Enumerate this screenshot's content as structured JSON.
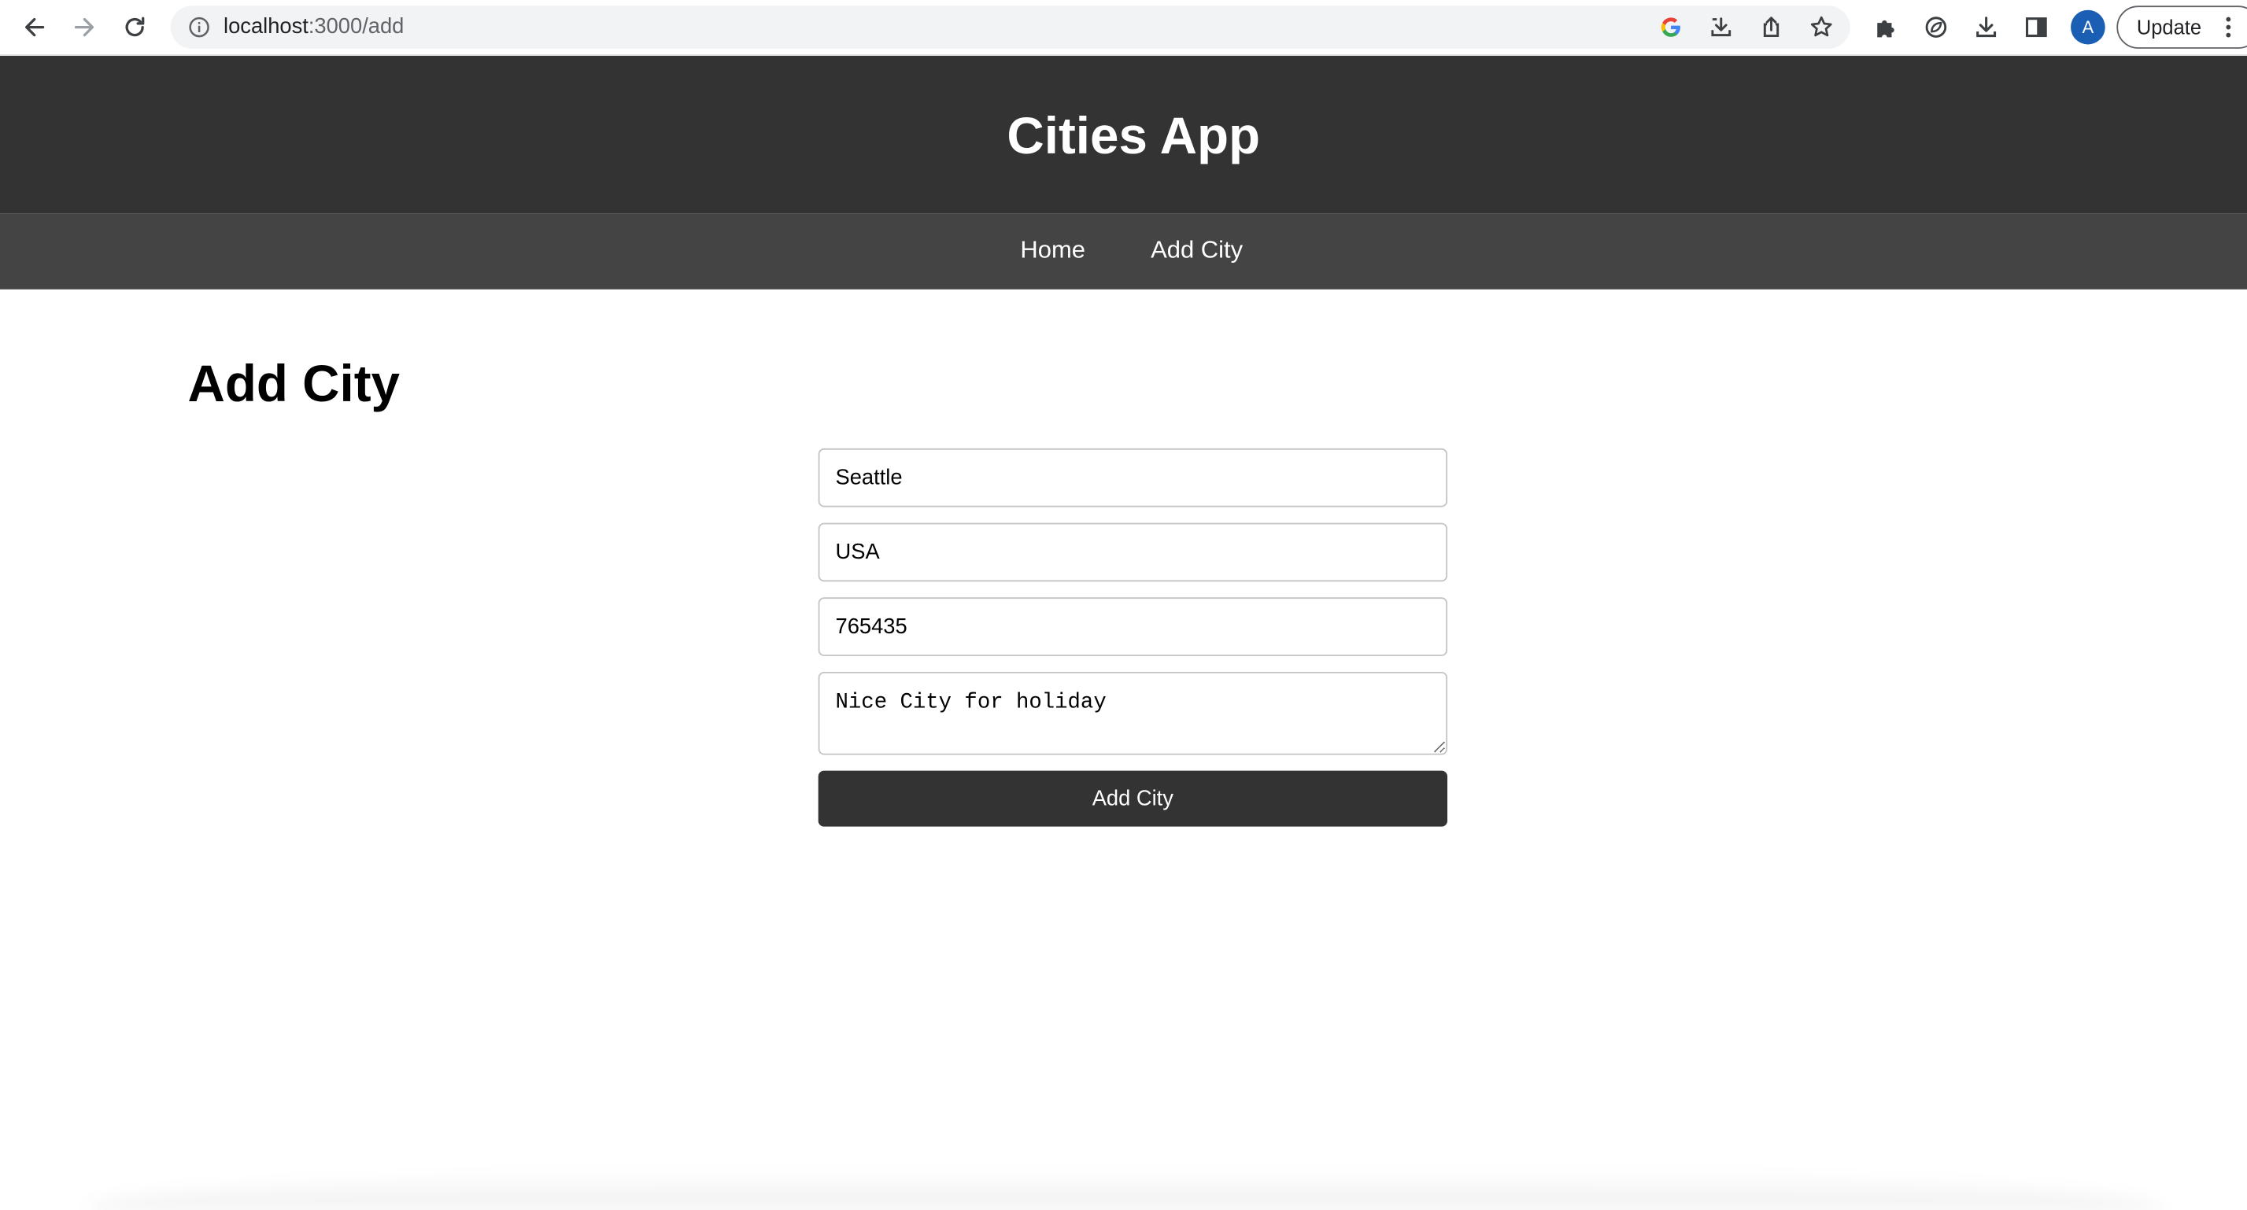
{
  "browser": {
    "url_host": "localhost",
    "url_path": ":3000/add",
    "profile_initial": "A",
    "update_label": "Update"
  },
  "header": {
    "title": "Cities App"
  },
  "nav": {
    "items": [
      {
        "label": "Home"
      },
      {
        "label": "Add City"
      }
    ]
  },
  "main": {
    "heading": "Add City",
    "form": {
      "name_value": "Seattle",
      "country_value": "USA",
      "population_value": "765435",
      "description_value": "Nice City for holiday",
      "submit_label": "Add City"
    }
  },
  "colors": {
    "header_bg": "#333333",
    "nav_bg": "#444444",
    "button_bg": "#333333",
    "avatar_bg": "#1a5fb4"
  }
}
